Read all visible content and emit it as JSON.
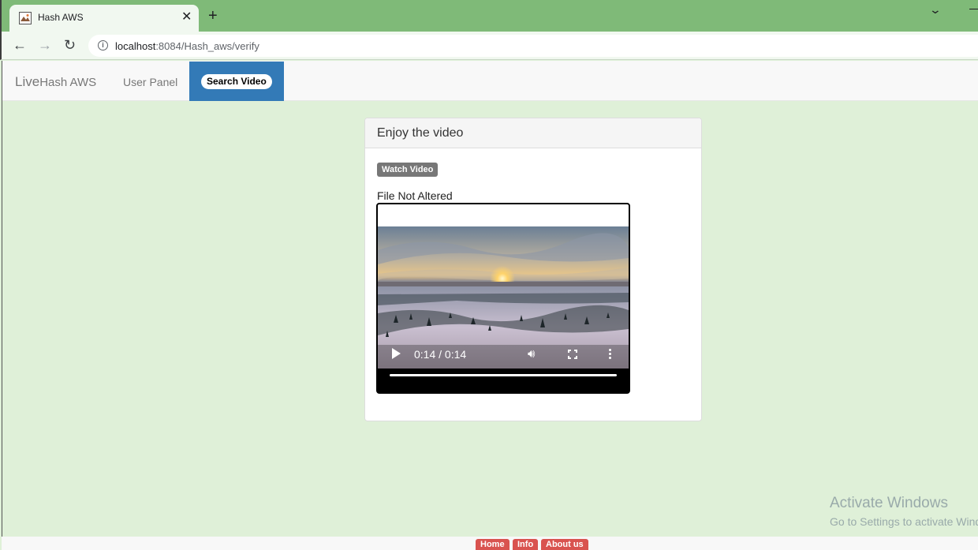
{
  "browser": {
    "tab_title": "Hash AWS",
    "tab_close": "✕",
    "new_tab": "+",
    "url_host": "localhost",
    "url_path": ":8084/Hash_aws/verify"
  },
  "navbar": {
    "brand_prefix": "Live",
    "brand_name": "Hash AWS",
    "user_panel": "User Panel",
    "search_video": "Search Video"
  },
  "panel": {
    "heading": "Enjoy the video",
    "watch_button": "Watch Video",
    "status": "File Not Altered"
  },
  "video": {
    "time": "0:14 / 0:14",
    "progress": 1.0
  },
  "watermark": {
    "title": "Activate Windows",
    "subtitle": "Go to Settings to activate Windows."
  },
  "footer": {
    "home": "Home",
    "info": "Info",
    "about": "About us"
  },
  "colors": {
    "tabbar": "#7fba78",
    "page_bg": "#dff0d8",
    "nav_active": "#337ab7",
    "footer_btn": "#d9534f"
  }
}
